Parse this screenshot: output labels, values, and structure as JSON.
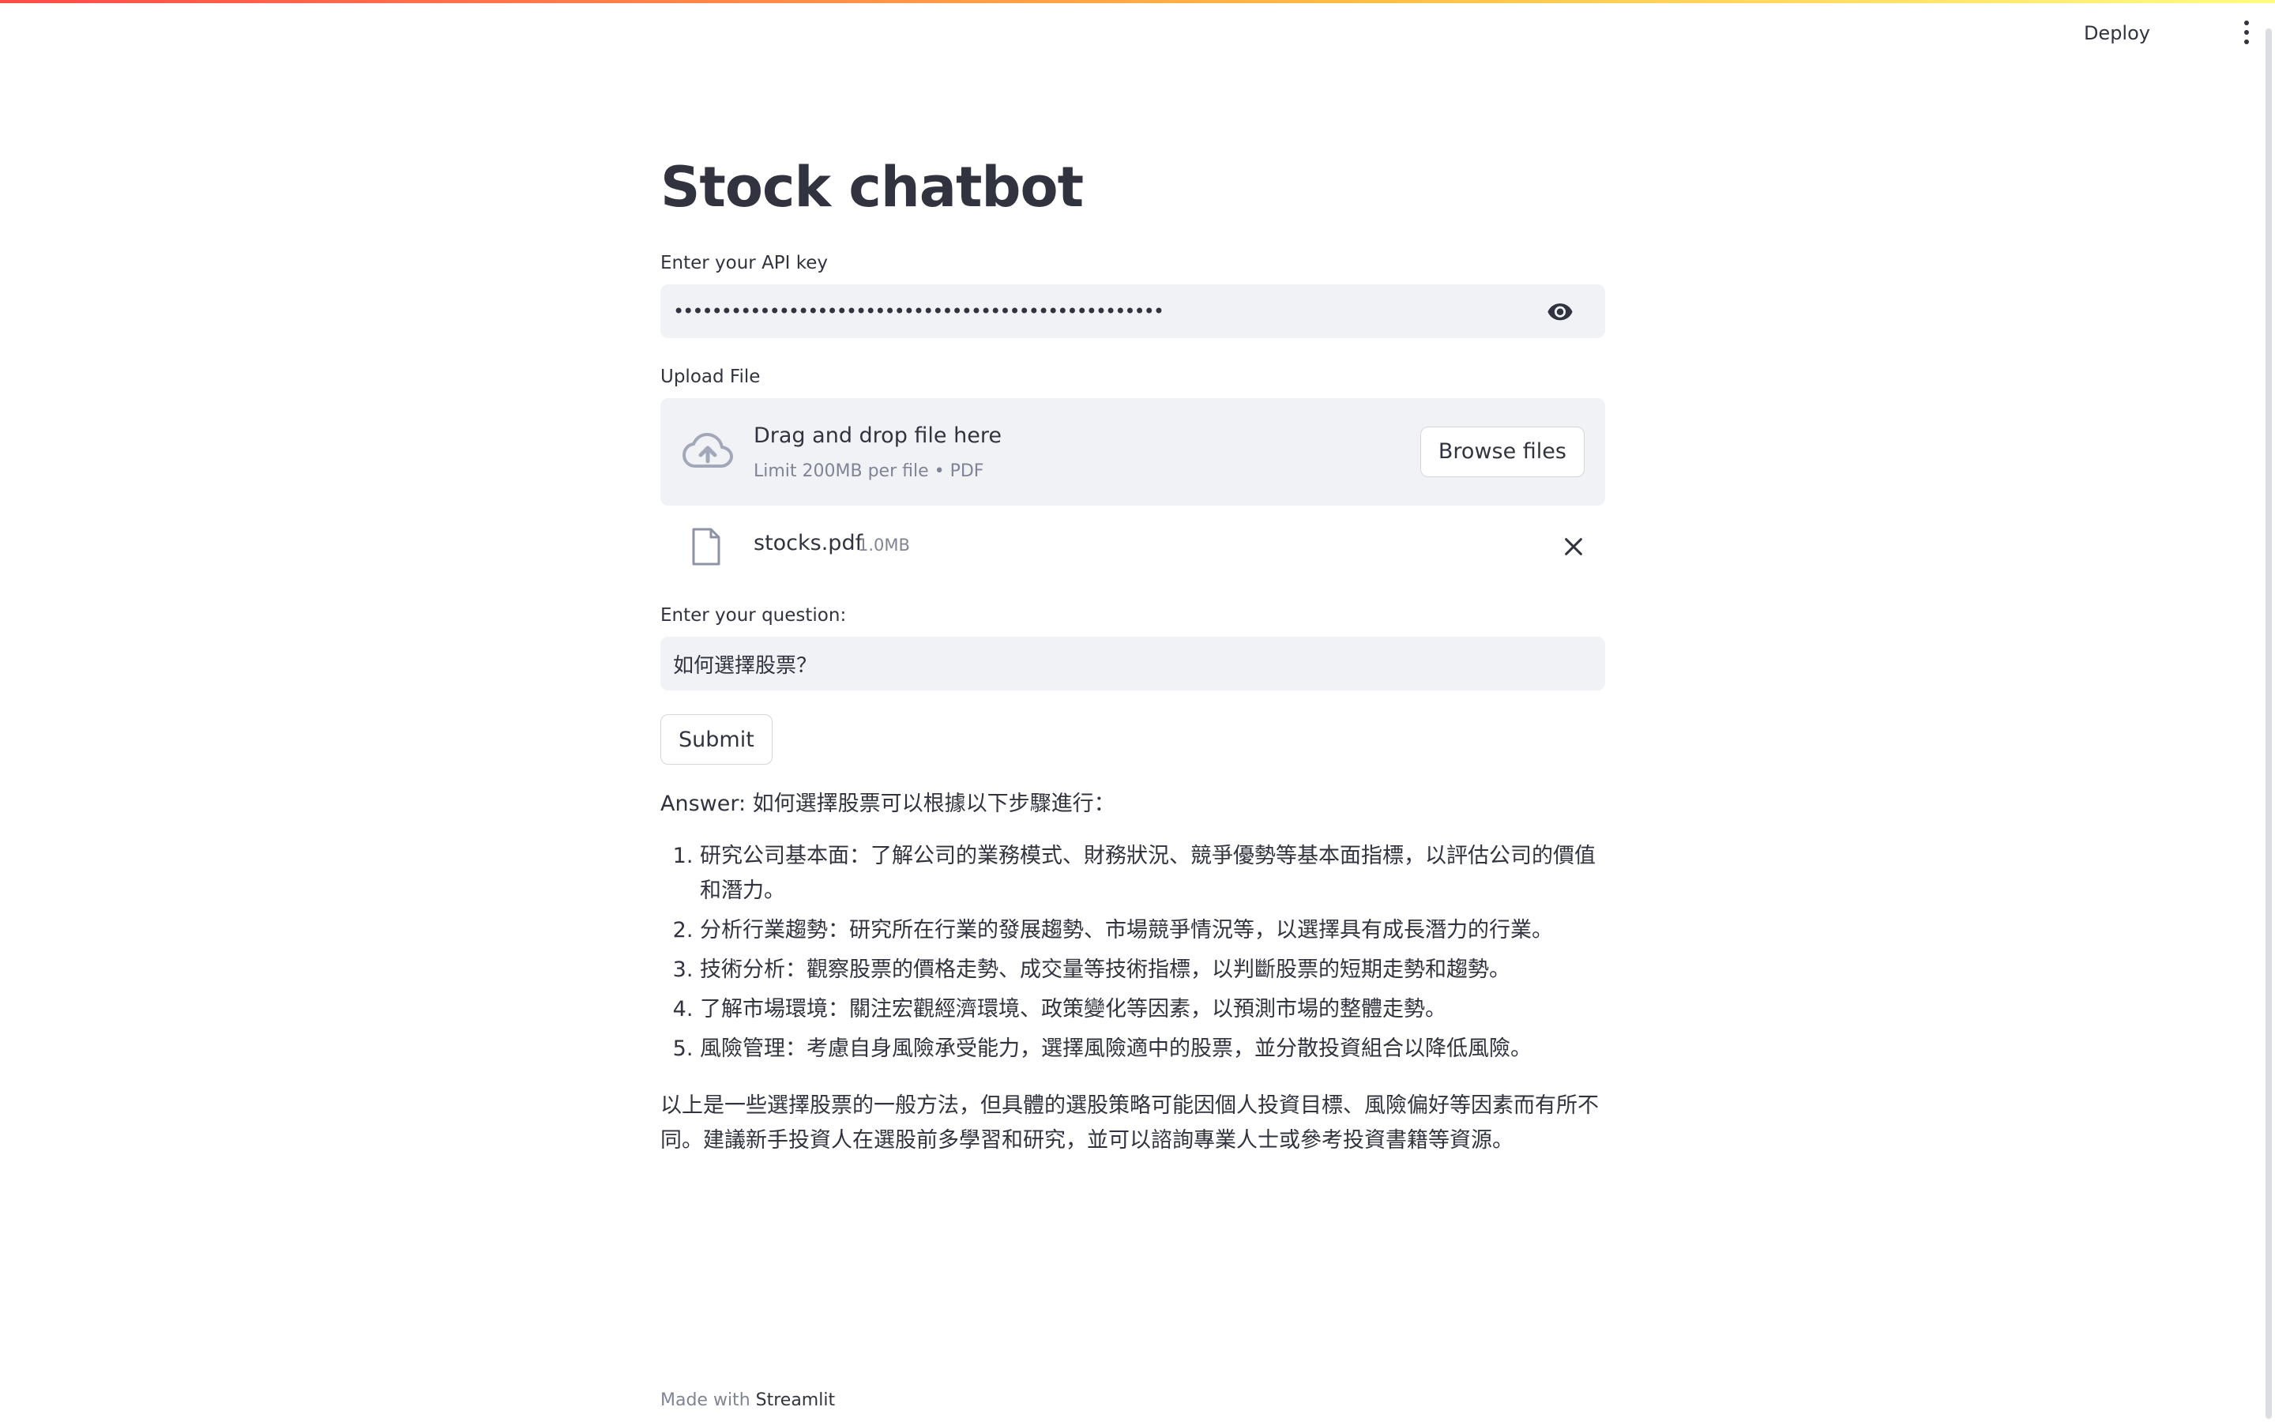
{
  "header": {
    "deploy_label": "Deploy",
    "menu_icon": "kebab-menu-icon"
  },
  "main": {
    "title": "Stock chatbot",
    "api_key": {
      "label": "Enter your API key",
      "value": "•••••••••••••••••••••••••••••••••••••••••••••••••••",
      "toggle_icon": "eye-icon"
    },
    "upload": {
      "label": "Upload File",
      "drop_title": "Drag and drop file here",
      "drop_subtitle": "Limit 200MB per file • PDF",
      "browse_label": "Browse files",
      "icon": "cloud-upload-icon",
      "file": {
        "name": "stocks.pdf",
        "size": "1.0MB",
        "icon": "file-icon",
        "remove_icon": "close-icon"
      }
    },
    "question": {
      "label": "Enter your question:",
      "value": "如何選擇股票？"
    },
    "submit_label": "Submit",
    "answer": {
      "intro": "Answer: 如何選擇股票可以根據以下步驟進行：",
      "steps": [
        "研究公司基本面：了解公司的業務模式、財務狀況、競爭優勢等基本面指標，以評估公司的價值和潛力。",
        "分析行業趨勢：研究所在行業的發展趨勢、市場競爭情況等，以選擇具有成長潛力的行業。",
        "技術分析：觀察股票的價格走勢、成交量等技術指標，以判斷股票的短期走勢和趨勢。",
        "了解市場環境：關注宏觀經濟環境、政策變化等因素，以預測市場的整體走勢。",
        "風險管理：考慮自身風險承受能力，選擇風險適中的股票，並分散投資組合以降低風險。"
      ],
      "closing": "以上是一些選擇股票的一般方法，但具體的選股策略可能因個人投資目標、風險偏好等因素而有所不同。建議新手投資人在選股前多學習和研究，並可以諮詢專業人士或參考投資書籍等資源。"
    }
  },
  "footer": {
    "prefix": "Made with",
    "brand": "Streamlit"
  }
}
